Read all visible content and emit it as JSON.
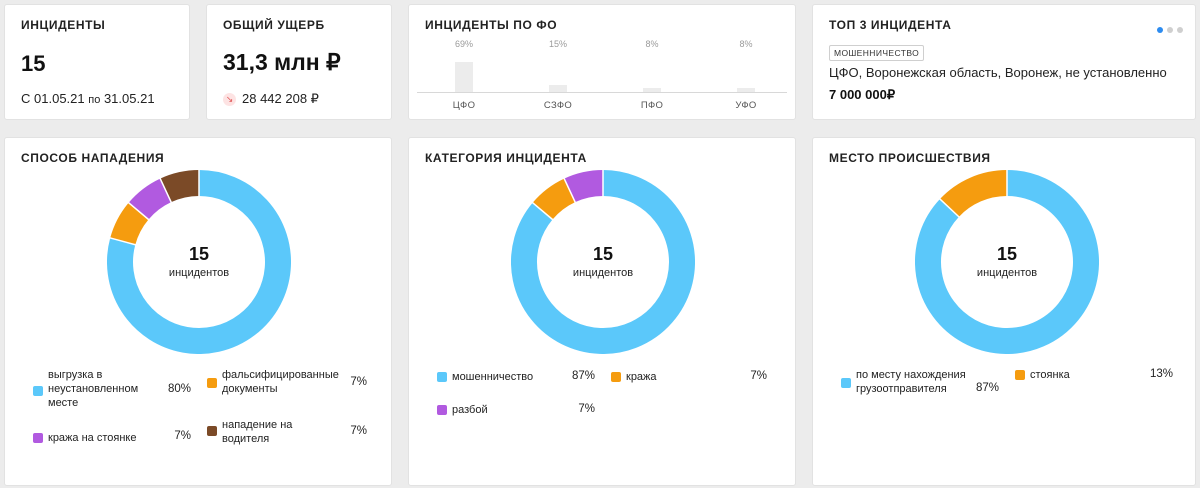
{
  "colors": {
    "blue": "#5bc8fa",
    "orange": "#f59c0f",
    "purple": "#b15ae0",
    "brown": "#7b4a27",
    "accent": "#2d8cf0"
  },
  "incidents_card": {
    "title": "ИНЦИДЕНТЫ",
    "value": "15",
    "period_from_label": "С",
    "period_from": "01.05.21",
    "period_to_label": "по",
    "period_to": "31.05.21"
  },
  "damage_card": {
    "title": "ОБЩИЙ УЩЕРБ",
    "value": "31,3 млн ₽",
    "loss_icon": "down-arrow-icon",
    "loss_value": "28 442 208 ₽"
  },
  "fo_card": {
    "title": "ИНЦИДЕНТЫ ПО ФО",
    "chart_data": {
      "type": "bar",
      "categories": [
        "ЦФО",
        "СЗФО",
        "ПФО",
        "УФО"
      ],
      "values": [
        69,
        15,
        8,
        8
      ],
      "labels": [
        "69%",
        "15%",
        "8%",
        "8%"
      ],
      "ylim": [
        0,
        100
      ]
    }
  },
  "top3_card": {
    "title": "ТОП 3 ИНЦИДЕНТА",
    "pages": 3,
    "active_page": 1,
    "tag": "МОШЕННИЧЕСТВО",
    "location": "ЦФО, Воронежская область, Воронеж, не установленно",
    "amount": "7 000 000₽"
  },
  "attack_card": {
    "title": "СПОСОБ НАПАДЕНИЯ",
    "total": "15",
    "total_label": "инцидентов",
    "chart_data": {
      "type": "pie",
      "categories": [
        "выгрузка в неустановленном месте",
        "фальсифицированные документы",
        "кража на стоянке",
        "нападение на водителя"
      ],
      "values": [
        80,
        7,
        7,
        7
      ],
      "colors": [
        "#5bc8fa",
        "#f59c0f",
        "#b15ae0",
        "#7b4a27"
      ]
    },
    "legend": [
      {
        "label": "выгрузка в неустановленном месте",
        "pct": "80%"
      },
      {
        "label": "фальсифицированные документы",
        "pct": "7%"
      },
      {
        "label": "кража на стоянке",
        "pct": "7%"
      },
      {
        "label": "нападение на водителя",
        "pct": "7%"
      }
    ]
  },
  "category_card": {
    "title": "КАТЕГОРИЯ ИНЦИДЕНТА",
    "total": "15",
    "total_label": "инцидентов",
    "chart_data": {
      "type": "pie",
      "categories": [
        "мошенничество",
        "кража",
        "разбой"
      ],
      "values": [
        87,
        7,
        7
      ],
      "colors": [
        "#5bc8fa",
        "#f59c0f",
        "#b15ae0"
      ]
    },
    "legend": [
      {
        "label": "мошенничество",
        "pct": "87%"
      },
      {
        "label": "кража",
        "pct": "7%"
      },
      {
        "label": "разбой",
        "pct": "7%"
      }
    ]
  },
  "place_card": {
    "title": "МЕСТО ПРОИСШЕСТВИЯ",
    "total": "15",
    "total_label": "инцидентов",
    "chart_data": {
      "type": "pie",
      "categories": [
        "по месту нахождения грузоотправителя",
        "стоянка"
      ],
      "values": [
        87,
        13
      ],
      "colors": [
        "#5bc8fa",
        "#f59c0f"
      ]
    },
    "legend": [
      {
        "label": "по месту нахождения грузоотправителя",
        "pct": "87%"
      },
      {
        "label": "стоянка",
        "pct": "13%"
      }
    ]
  }
}
